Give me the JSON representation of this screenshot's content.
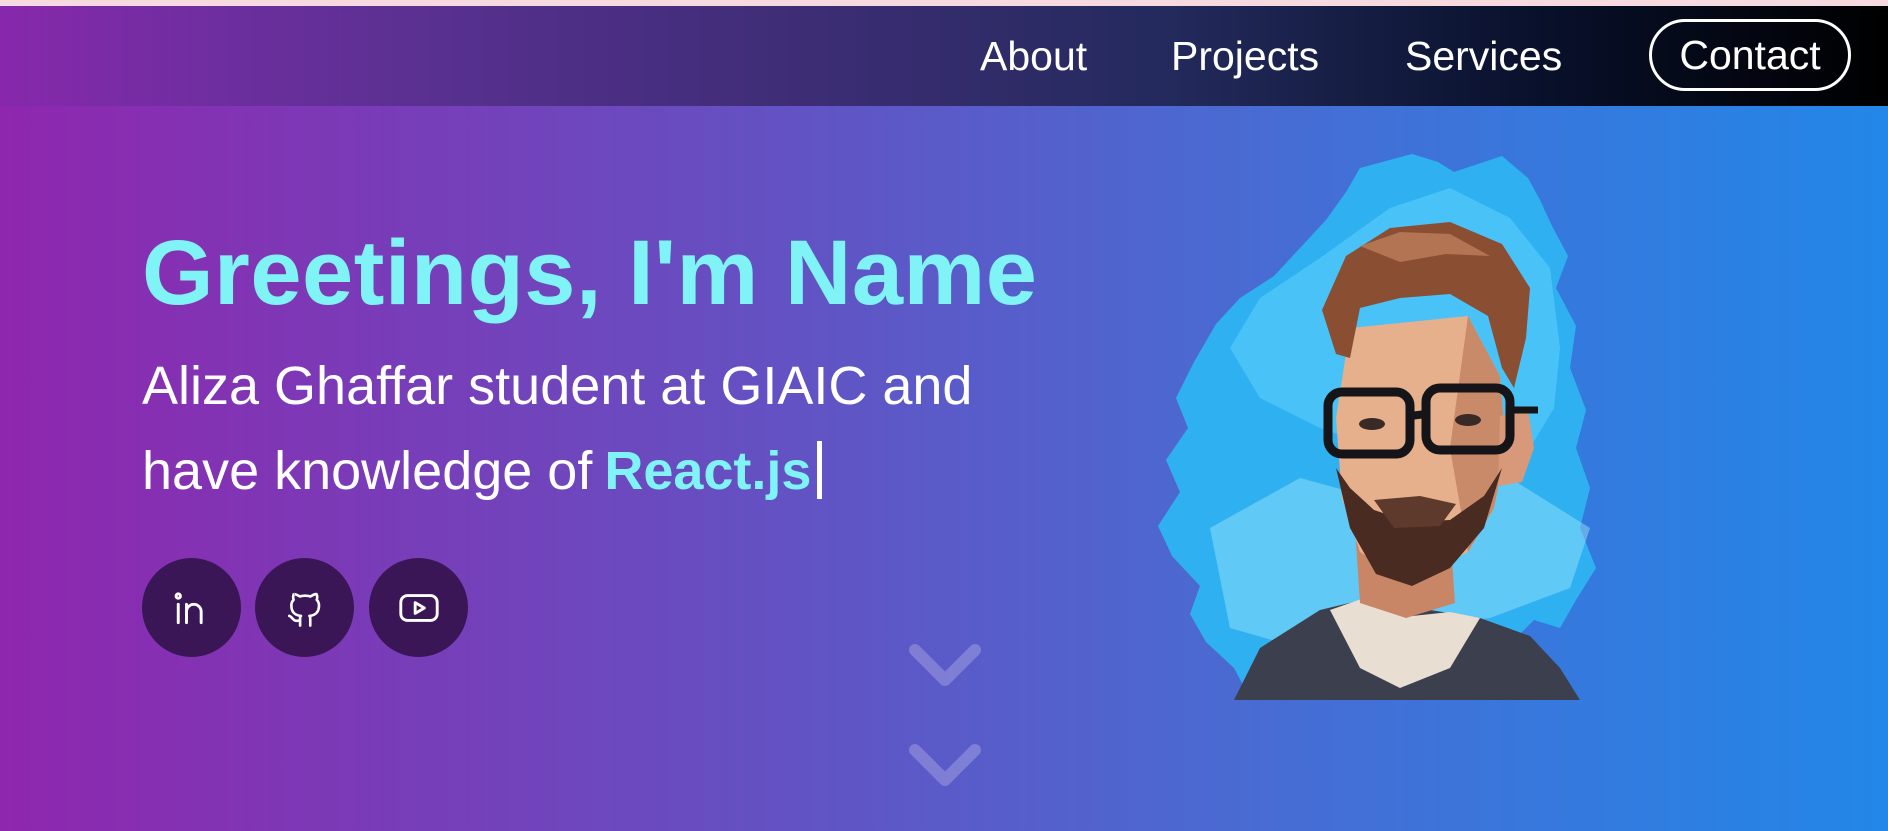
{
  "nav": {
    "items": [
      {
        "label": "About"
      },
      {
        "label": "Projects"
      },
      {
        "label": "Services"
      }
    ],
    "contact_label": "Contact"
  },
  "hero": {
    "headline": "Greetings, I'm Name",
    "intro_line1": "Aliza Ghaffar student at GIAIC and",
    "intro_line2": "have knowledge of",
    "typed_text": "React.js",
    "social": [
      {
        "icon": "linkedin-icon"
      },
      {
        "icon": "github-icon"
      },
      {
        "icon": "youtube-icon"
      }
    ],
    "scroll_indicator_icon": "chevron-down-icon",
    "avatar": "illustrated-portrait"
  },
  "colors": {
    "accent": "#7ff3f6",
    "text": "#ffffff",
    "social_bg": "#3a1656",
    "gradient_left": "#8e27ae",
    "gradient_right": "#2287e8",
    "nav_dark": "#000000"
  }
}
